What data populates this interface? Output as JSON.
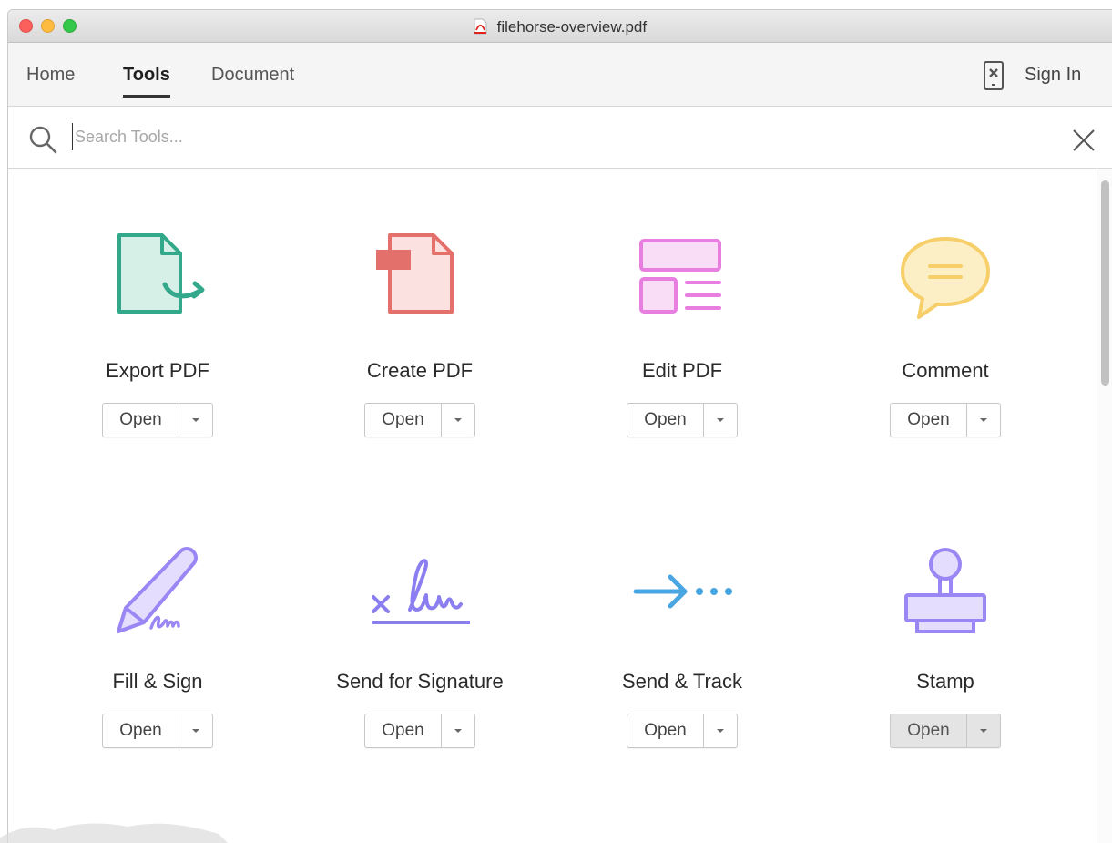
{
  "window": {
    "title": "filehorse-overview.pdf"
  },
  "nav": {
    "tabs": [
      {
        "label": "Home",
        "active": false
      },
      {
        "label": "Tools",
        "active": true
      },
      {
        "label": "Document",
        "active": false
      }
    ],
    "mobile_icon": "mobile-link-icon",
    "sign_in_label": "Sign In"
  },
  "search": {
    "placeholder": "Search Tools...",
    "value": ""
  },
  "tools": [
    {
      "name": "Export PDF",
      "icon": "export-pdf-icon",
      "button": "Open",
      "color": "#34a88a"
    },
    {
      "name": "Create PDF",
      "icon": "create-pdf-icon",
      "button": "Open",
      "color": "#e4706b"
    },
    {
      "name": "Edit PDF",
      "icon": "edit-pdf-icon",
      "button": "Open",
      "color": "#e87ee0"
    },
    {
      "name": "Comment",
      "icon": "comment-icon",
      "button": "Open",
      "color": "#f6cf6a"
    },
    {
      "name": "Fill & Sign",
      "icon": "fill-sign-icon",
      "button": "Open",
      "color": "#9a86f4"
    },
    {
      "name": "Send for Signature",
      "icon": "send-signature-icon",
      "button": "Open",
      "color": "#8a7ef0"
    },
    {
      "name": "Send & Track",
      "icon": "send-track-icon",
      "button": "Open",
      "color": "#4aa6e0"
    },
    {
      "name": "Stamp",
      "icon": "stamp-icon",
      "button": "Open",
      "color": "#9a86f4"
    }
  ]
}
